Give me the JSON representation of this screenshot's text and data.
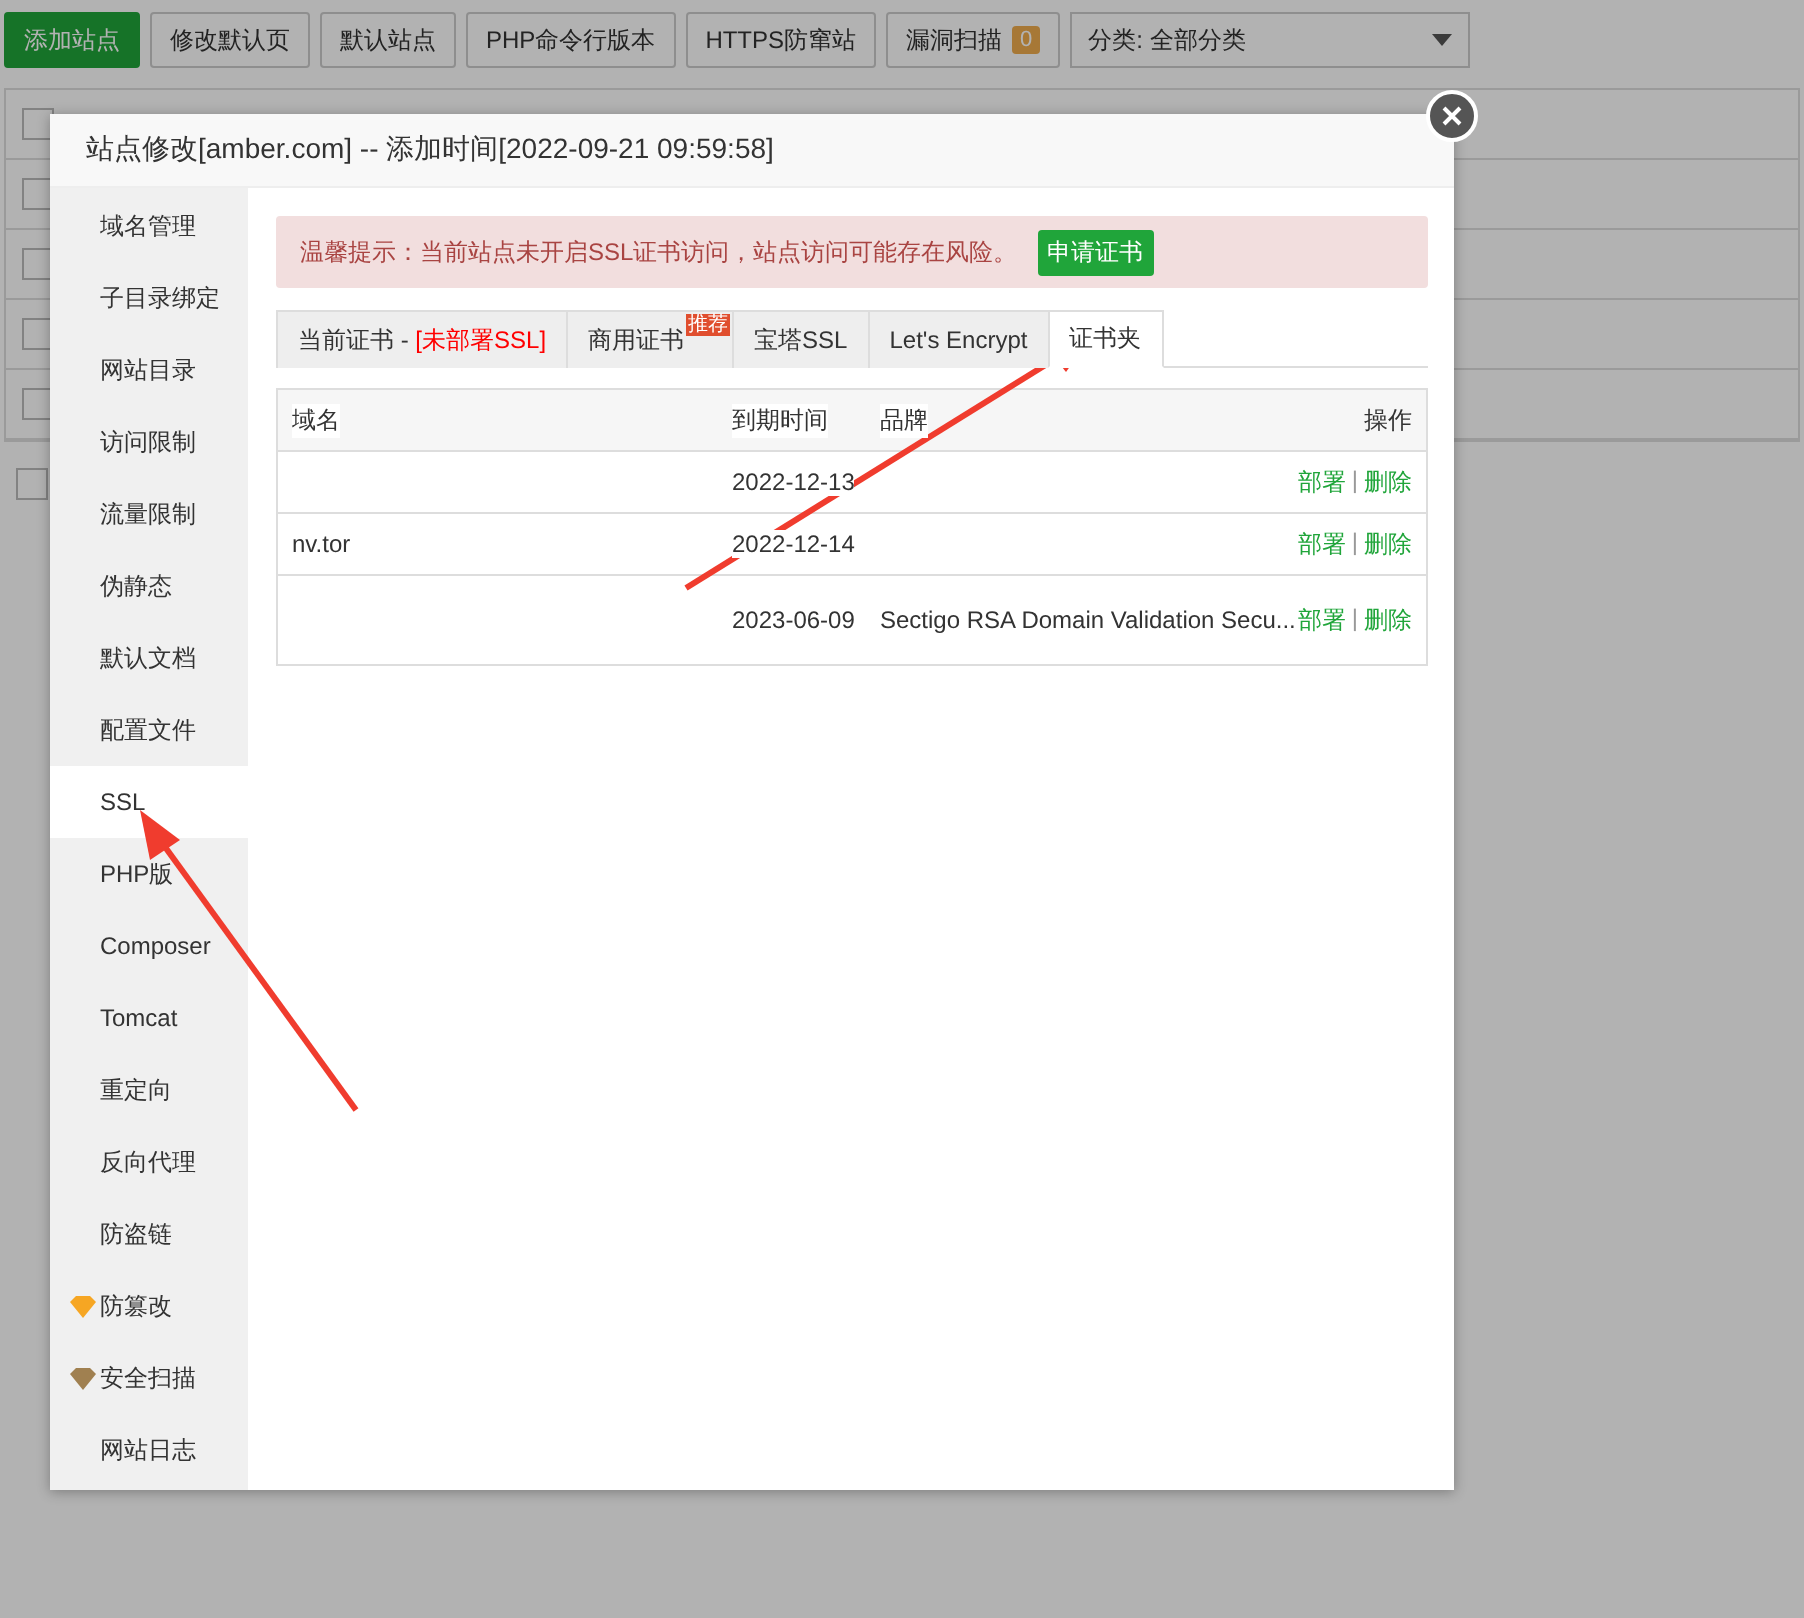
{
  "toolbar": {
    "buttons": [
      {
        "label": "添加站点",
        "kind": "primary"
      },
      {
        "label": "修改默认页",
        "kind": "plain"
      },
      {
        "label": "默认站点",
        "kind": "plain"
      },
      {
        "label": "PHP命令行版本",
        "kind": "plain"
      },
      {
        "label": "HTTPS防窜站",
        "kind": "plain"
      },
      {
        "label": "漏洞扫描",
        "kind": "badge",
        "badge": "0"
      }
    ],
    "category": "分类: 全部分类"
  },
  "background_rows": [
    {
      "checked": false
    },
    {
      "checked": false
    },
    {
      "checked": false
    },
    {
      "checked": false
    },
    {
      "checked": false
    }
  ],
  "select_all": {
    "checked": false
  },
  "modal": {
    "title": "站点修改[amber.com] -- 添加时间[2022-09-21 09:59:58]",
    "sidebar": [
      {
        "label": "域名管理",
        "selected": false
      },
      {
        "label": "子目录绑定",
        "selected": false
      },
      {
        "label": "网站目录",
        "selected": false
      },
      {
        "label": "访问限制",
        "selected": false
      },
      {
        "label": "流量限制",
        "selected": false
      },
      {
        "label": "伪静态",
        "selected": false
      },
      {
        "label": "默认文档",
        "selected": false
      },
      {
        "label": "配置文件",
        "selected": false
      },
      {
        "label": "SSL",
        "selected": true
      },
      {
        "label": "PHP版",
        "selected": false
      },
      {
        "label": "Composer",
        "selected": false
      },
      {
        "label": "Tomcat",
        "selected": false
      },
      {
        "label": "重定向",
        "selected": false
      },
      {
        "label": "反向代理",
        "selected": false
      },
      {
        "label": "防盗链",
        "selected": false
      },
      {
        "label": "防篡改",
        "selected": false,
        "kind": "gold-gem"
      },
      {
        "label": "安全扫描",
        "selected": false,
        "kind": "bronze-gem"
      },
      {
        "label": "网站日志",
        "selected": false
      }
    ],
    "alert": {
      "text": "温馨提示：当前站点未开启SSL证书访问，站点访问可能存在风险。",
      "button": "申请证书"
    },
    "tabs": [
      {
        "label": "当前证书 - ",
        "status": "[未部署SSL]",
        "selected": false
      },
      {
        "label": "商用证书",
        "ribbon": "推荐",
        "selected": false
      },
      {
        "label": "宝塔SSL",
        "selected": false
      },
      {
        "label": "Let's Encrypt",
        "selected": false
      },
      {
        "label": "证书夹",
        "selected": true
      }
    ],
    "table": {
      "columns": [
        "域名",
        "到期时间",
        "品牌",
        "操作"
      ],
      "rows": [
        {
          "expiry": "2022-12-13",
          "actions": [
            "部署",
            "删除"
          ],
          "separator": "|"
        },
        {
          "domain": "nv.tor",
          "expiry": "2022-12-14",
          "actions": [
            "部署",
            "删除"
          ],
          "separator": "|"
        },
        {
          "expiry": "2023-06-09",
          "brand": "Sectigo RSA Domain Validation Secu...",
          "actions": [
            "部署",
            "删除"
          ],
          "separator": "|"
        }
      ]
    }
  }
}
